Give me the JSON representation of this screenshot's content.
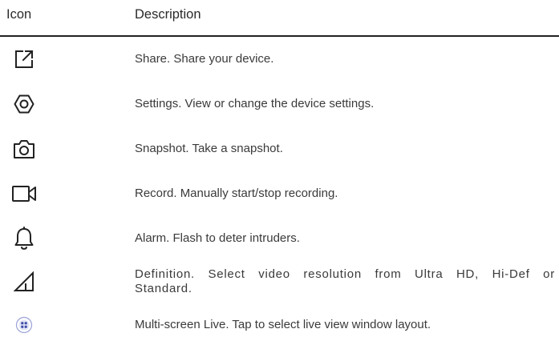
{
  "table": {
    "headers": {
      "icon": "Icon",
      "description": "Description"
    },
    "rows": [
      {
        "icon": "share-icon",
        "description": "Share. Share your device."
      },
      {
        "icon": "settings-icon",
        "description": "Settings. View or change the device settings."
      },
      {
        "icon": "camera-icon",
        "description": "Snapshot. Take a snapshot."
      },
      {
        "icon": "video-camera-icon",
        "description": "Record. Manually start/stop recording."
      },
      {
        "icon": "bell-icon",
        "description": "Alarm. Flash to deter intruders."
      },
      {
        "icon": "signal-triangle-icon",
        "description": "Definition. Select video resolution from Ultra HD, Hi-Def or Standard."
      },
      {
        "icon": "multi-screen-icon",
        "description": "Multi-screen Live. Tap to select live view window layout."
      }
    ]
  },
  "colors": {
    "text": "#3a3a3a",
    "icon_stroke": "#222222",
    "multi_screen_accent": "#3d4aa8",
    "multi_screen_fill": "#e3e6f6"
  }
}
